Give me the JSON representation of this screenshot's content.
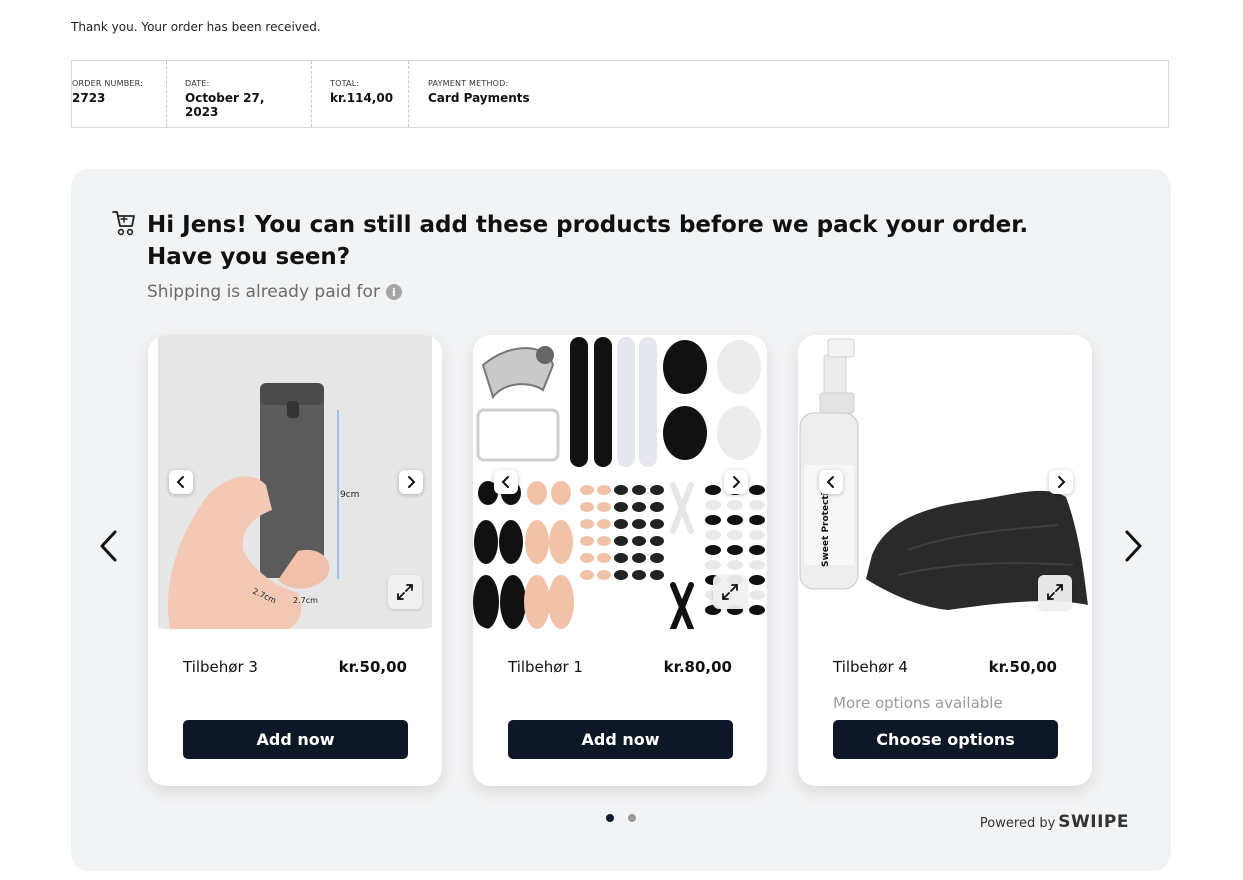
{
  "confirmation": {
    "message": "Thank you. Your order has been received."
  },
  "order": {
    "number_label": "ORDER NUMBER:",
    "number": "2723",
    "date_label": "DATE:",
    "date": "October 27, 2023",
    "total_label": "TOTAL:",
    "total": "kr.114,00",
    "payment_label": "PAYMENT METHOD:",
    "payment": "Card Payments"
  },
  "upsell": {
    "headline": "Hi Jens! You can still add these products before we pack your order. Have you seen?",
    "subline": "Shipping is already paid for",
    "info_icon": "i",
    "products": [
      {
        "name": "Tilbehør 3",
        "price": "kr.50,00",
        "more": "",
        "button": "Add now",
        "dimension_height": "9cm",
        "dimension_depth": "2.7cm",
        "dimension_width": "2.7cm"
      },
      {
        "name": "Tilbehør 1",
        "price": "kr.80,00",
        "more": "",
        "button": "Add now"
      },
      {
        "name": "Tilbehør 4",
        "price": "kr.50,00",
        "more": "More options available",
        "button": "Choose options",
        "bottle_label": "Sweet Protection"
      }
    ],
    "pagination": {
      "pages": 2,
      "active": 1
    },
    "powered_by": "Powered by",
    "brand": "SWIIPE"
  },
  "colors": {
    "button": "#0d1726",
    "panel": "#f2f3f4",
    "dot_active": "#111c2e",
    "dot_inactive": "#9a9a9a"
  },
  "icons": [
    "cart-icon",
    "info-icon",
    "chevron-left-icon",
    "chevron-right-icon",
    "expand-icon"
  ]
}
